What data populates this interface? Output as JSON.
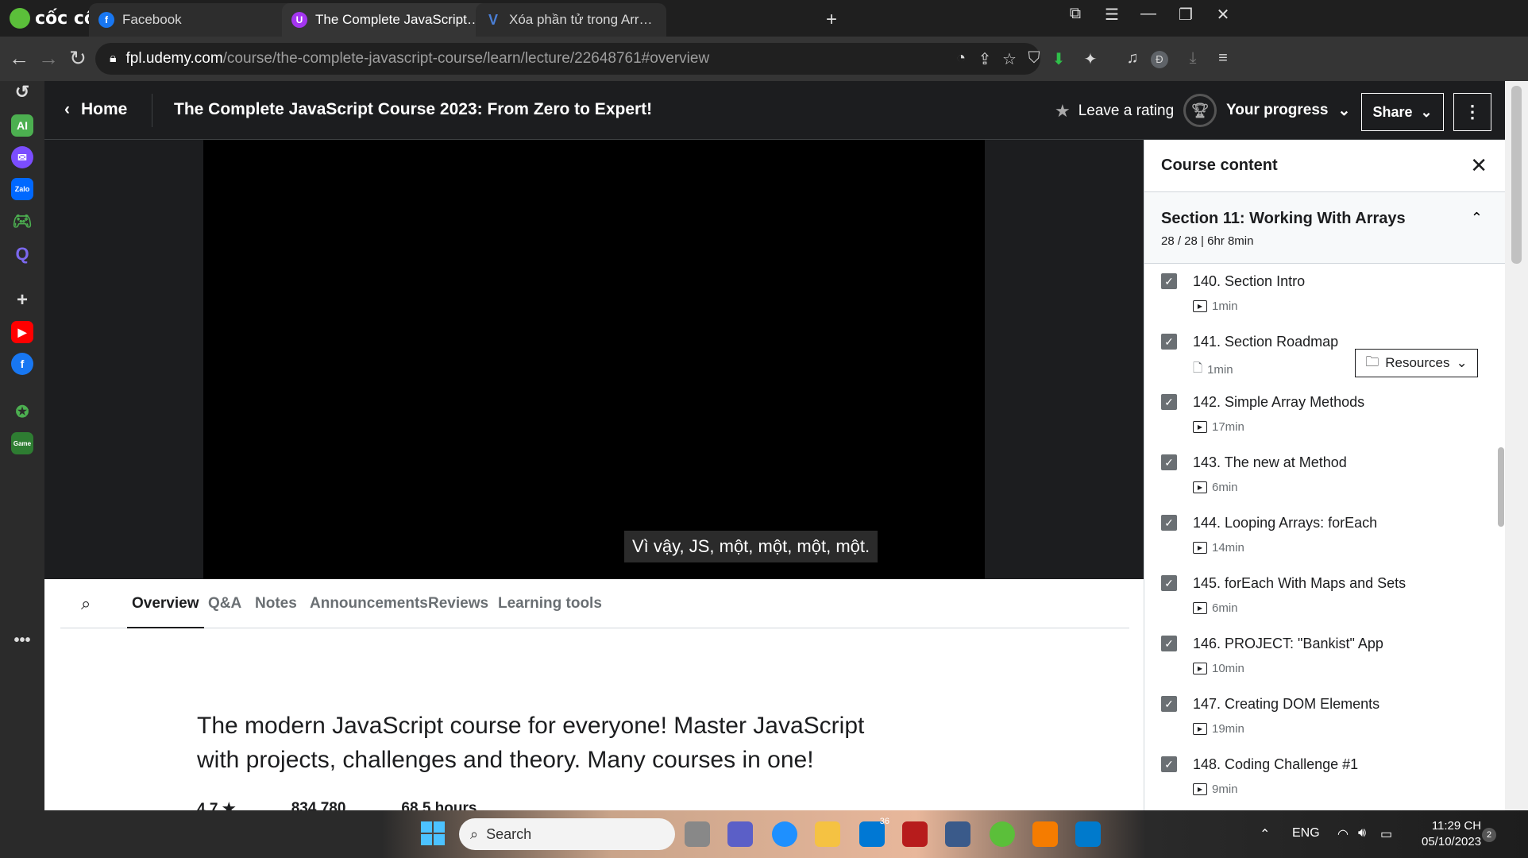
{
  "browser": {
    "brand": "cốc cốc",
    "tabs": [
      {
        "label": "Facebook",
        "active": false
      },
      {
        "label": "The Complete JavaScript Course",
        "active": true
      },
      {
        "label": "Xóa phần tử trong Array JavaScript",
        "active": false
      }
    ],
    "url_host": "fpl.udemy.com",
    "url_path": "/course/the-complete-javascript-course/learn/lecture/22648761#overview",
    "profile_initial": "Đ"
  },
  "header": {
    "home_label": "Home",
    "course_title": "The Complete JavaScript Course 2023: From Zero to Expert!",
    "rating_label": "Leave a rating",
    "progress_label": "Your progress",
    "share_label": "Share"
  },
  "video": {
    "subtitle": "Vì vậy, JS, một, một, một, một."
  },
  "main": {
    "tabs": [
      "Overview",
      "Q&A",
      "Notes",
      "Announcements",
      "Reviews",
      "Learning tools"
    ],
    "active_tab": "Overview",
    "description": "The modern JavaScript course for everyone! Master JavaScript with projects, challenges and theory. Many courses in one!",
    "stats": {
      "rating": "4.7 ★",
      "students": "834,780",
      "hours": "68.5 hours"
    }
  },
  "course_content": {
    "title": "Course content",
    "section_title": "Section 11: Working With Arrays",
    "section_meta": "28 / 28 | 6hr 8min",
    "lectures": [
      {
        "title": "140. Section Intro",
        "duration": "1min",
        "kind": "video",
        "done": true
      },
      {
        "title": "141. Section Roadmap",
        "duration": "1min",
        "kind": "document",
        "done": true,
        "resources": "Resources"
      },
      {
        "title": "142. Simple Array Methods",
        "duration": "17min",
        "kind": "video",
        "done": true
      },
      {
        "title": "143. The new at Method",
        "duration": "6min",
        "kind": "video",
        "done": true
      },
      {
        "title": "144. Looping Arrays: forEach",
        "duration": "14min",
        "kind": "video",
        "done": true
      },
      {
        "title": "145. forEach With Maps and Sets",
        "duration": "6min",
        "kind": "video",
        "done": true
      },
      {
        "title": "146. PROJECT: \"Bankist\" App",
        "duration": "10min",
        "kind": "video",
        "done": true
      },
      {
        "title": "147. Creating DOM Elements",
        "duration": "19min",
        "kind": "video",
        "done": true
      },
      {
        "title": "148. Coding Challenge #1",
        "duration": "9min",
        "kind": "video",
        "done": true
      }
    ]
  },
  "taskbar": {
    "search_label": "Search",
    "language": "ENG",
    "time": "11:29 CH",
    "date": "05/10/2023",
    "notification_count": "2",
    "badge_count": "36"
  },
  "colors": {
    "udemy_dark": "#1c1d1f",
    "accent_green": "#5bbf3a",
    "checkbox": "#6a6f73"
  }
}
